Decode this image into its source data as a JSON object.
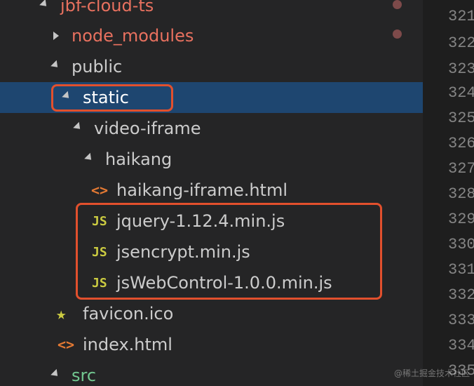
{
  "explorer": {
    "items": [
      {
        "label": "jbf-cloud-ts",
        "type": "folder",
        "expanded": true,
        "color": "#e8715f"
      },
      {
        "label": "node_modules",
        "type": "folder",
        "expanded": false,
        "color": "#e8715f"
      },
      {
        "label": "public",
        "type": "folder",
        "expanded": true,
        "color": "#cccccc"
      },
      {
        "label": "static",
        "type": "folder",
        "expanded": true,
        "color": "#ffffff",
        "selected": true
      },
      {
        "label": "video-iframe",
        "type": "folder",
        "expanded": true,
        "color": "#cccccc"
      },
      {
        "label": "haikang",
        "type": "folder",
        "expanded": true,
        "color": "#cccccc"
      },
      {
        "label": "haikang-iframe.html",
        "type": "file",
        "icon": "html-icon",
        "icon_glyph": "<>",
        "color": "#cccccc"
      },
      {
        "label": "jquery-1.12.4.min.js",
        "type": "file",
        "icon": "js-icon",
        "icon_glyph": "JS",
        "color": "#cccccc"
      },
      {
        "label": "jsencrypt.min.js",
        "type": "file",
        "icon": "js-icon",
        "icon_glyph": "JS",
        "color": "#cccccc"
      },
      {
        "label": "jsWebControl-1.0.0.min.js",
        "type": "file",
        "icon": "js-icon",
        "icon_glyph": "JS",
        "color": "#cccccc"
      },
      {
        "label": "favicon.ico",
        "type": "file",
        "icon": "star-icon",
        "icon_glyph": "★",
        "color": "#cccccc"
      },
      {
        "label": "index.html",
        "type": "file",
        "icon": "html-icon",
        "icon_glyph": "<>",
        "color": "#cccccc"
      },
      {
        "label": "src",
        "type": "folder",
        "expanded": true,
        "color": "#73c991"
      }
    ]
  },
  "editor": {
    "line_numbers": [
      "321",
      "322",
      "323",
      "324",
      "325",
      "326",
      "327",
      "328",
      "329",
      "330",
      "331",
      "332",
      "333",
      "334",
      "335"
    ]
  },
  "watermark": "@稀土掘金技术社区",
  "colors": {
    "highlight": "#e2502d",
    "selected_row": "#1e4670",
    "sidebar_bg": "#252526",
    "editor_bg": "#1e1e1e"
  }
}
